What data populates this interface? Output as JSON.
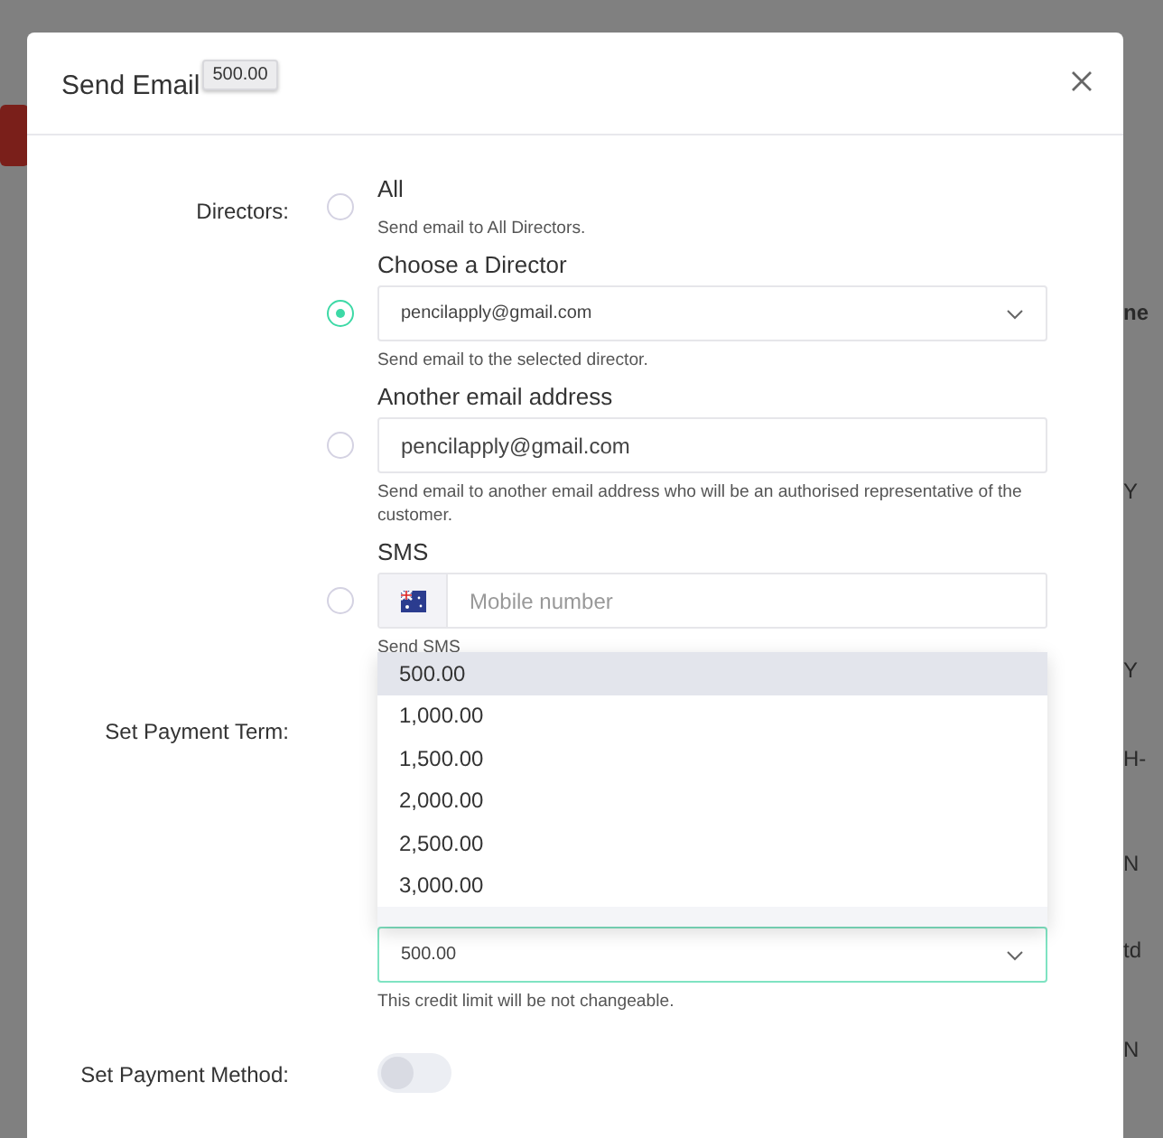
{
  "window": {
    "title": "Send Email",
    "tooltip": "500.00"
  },
  "background_fragments": [
    "ne",
    "Y",
    "Y",
    "H-",
    "N",
    "td",
    "N"
  ],
  "directors": {
    "label": "Directors:",
    "options": [
      {
        "kind": "plain",
        "title": "All",
        "hint": "Send email to All Directors.",
        "selected": false
      },
      {
        "kind": "select",
        "title": "Choose a Director",
        "value": "pencilapply@gmail.com",
        "hint": "Send email to the selected director.",
        "selected": true
      },
      {
        "kind": "input",
        "title": "Another email address",
        "value": "pencilapply@gmail.com",
        "hint": "Send email to another email address who will be an authorised representative of the customer.",
        "selected": false
      },
      {
        "kind": "phone",
        "title": "SMS",
        "placeholder": "Mobile number",
        "hint": "Send SMS",
        "selected": false
      }
    ]
  },
  "payment_term": {
    "label": "Set Payment Term:",
    "value": "500.00",
    "hint": "This credit limit will be not changeable.",
    "menu": [
      {
        "label": "500.00",
        "selected": true
      },
      {
        "label": "1,000.00",
        "selected": false
      },
      {
        "label": "1,500.00",
        "selected": false
      },
      {
        "label": "2,000.00",
        "selected": false
      },
      {
        "label": "2,500.00",
        "selected": false
      },
      {
        "label": "3,000.00",
        "selected": false
      }
    ]
  },
  "payment_method": {
    "label": "Set Payment Method:",
    "on": false
  }
}
